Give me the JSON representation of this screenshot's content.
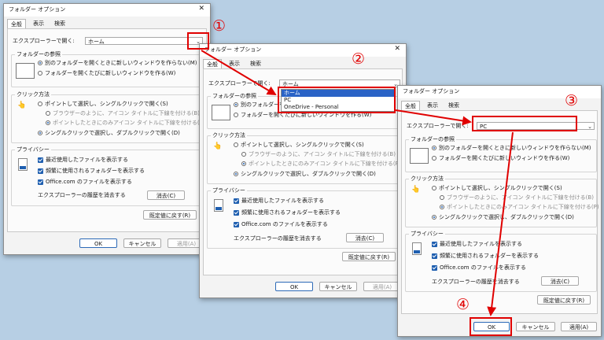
{
  "window_title": "フォルダー オプション",
  "tabs": [
    "全般",
    "表示",
    "検索"
  ],
  "open_label": "エクスプローラーで開く:",
  "combo": {
    "w1": "ホーム",
    "w2": "ホーム",
    "w3": "PC"
  },
  "dropdown": [
    "ホーム",
    "PC",
    "OneDrive - Personal"
  ],
  "browse": {
    "legend": "フォルダーの参照",
    "opt1": "別のフォルダーを開くときに新しいウィンドウを作らない(M)",
    "opt2": "フォルダーを開くたびに新しいウィンドウを作る(W)"
  },
  "click": {
    "legend": "クリック方法",
    "single": "ポイントして選択し、シングルクリックで開く(S)",
    "browser": "ブラウザーのように、アイコン タイトルに下線を付ける(B)",
    "point": "ポイントしたときにのみアイコン タイトルに下線を付ける(P)",
    "double": "シングルクリックで選択し、ダブルクリックで開く(D)"
  },
  "privacy": {
    "legend": "プライバシー",
    "recent": "最近使用したファイルを表示する",
    "frequent": "頻繁に使用されるフォルダーを表示する",
    "office": "Office.com のファイルを表示する",
    "clear_label": "エクスプローラーの履歴を消去する",
    "clear_btn": "消去(C)"
  },
  "restore": "既定値に戻す(R)",
  "ok": "OK",
  "cancel": "キャンセル",
  "apply": "適用(A)",
  "markers": {
    "m1": "①",
    "m2": "②",
    "m3": "③",
    "m4": "④"
  },
  "colors": {
    "annotation": "#e00000",
    "accent": "#1f5fb0",
    "background": "#b7cfe4"
  }
}
